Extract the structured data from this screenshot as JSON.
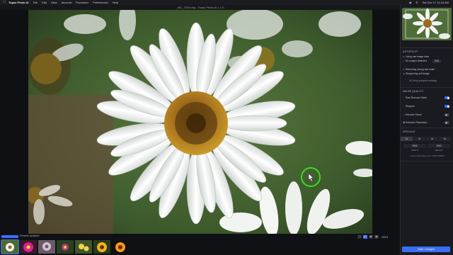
{
  "menubar": {
    "app_name": "Topaz Photo AI",
    "menus": [
      "File",
      "Edit",
      "View",
      "Account",
      "Processor",
      "Preferences",
      "Help"
    ],
    "clock": "Sat Dec 17 11:44 AM"
  },
  "window": {
    "title": "_MG_7519.dng · Topaz Photo AI 1.1.0"
  },
  "panel": {
    "autopilot_title": "AUTOPILOT",
    "autopilot_rows": [
      "Using raw image data",
      "No subject detected",
      "Removing strong raw noise",
      "Sharpening soft image"
    ],
    "edit_button": "Edit",
    "autopilot_settings": "Using autopilot settings",
    "quality_title": "IMAGE QUALITY",
    "modules": [
      {
        "label": "Raw Remove Noise",
        "on": true
      },
      {
        "label": "Sharpen",
        "on": true
      },
      {
        "label": "Recover Faces",
        "on": false
      },
      {
        "label": "Enhance Resolution",
        "on": false
      }
    ],
    "upscale_title": "UPSCALE",
    "scale_options": [
      "1x",
      "2x",
      "4x",
      "6x"
    ],
    "width_value": "5968",
    "height_value": "3965",
    "width_label": "WIDTH",
    "height_label": "HEIGHT",
    "output_note": "Output dpi/image size: 5968x3965px"
  },
  "bottom": {
    "preview_label": "Preview Updated",
    "zoom": "100%",
    "save_label": "Save 1 images"
  },
  "colors": {
    "accent": "#3b6ef5",
    "cursor_ring": "#39d82b"
  }
}
